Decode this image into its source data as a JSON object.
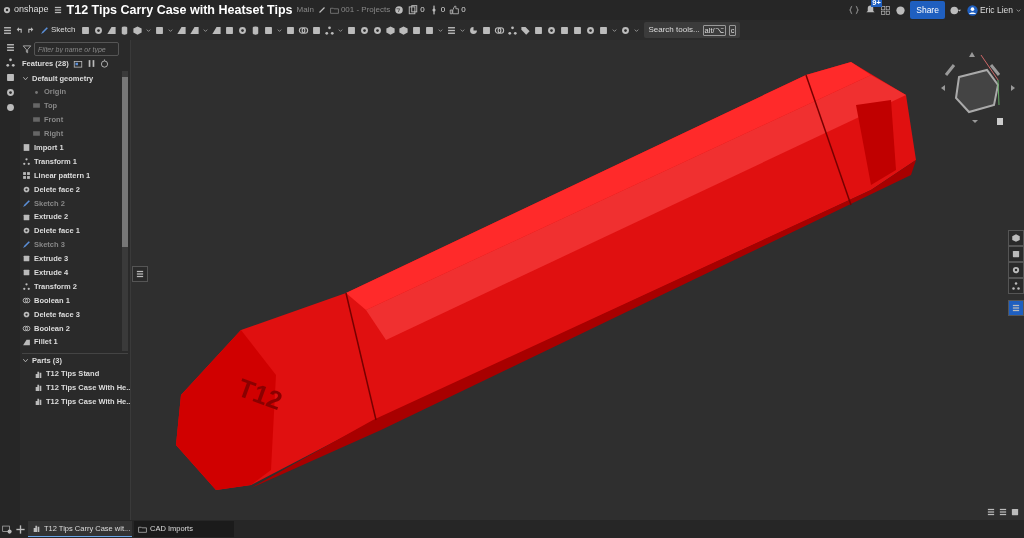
{
  "app": {
    "logo_text": "onshape",
    "title": "T12 Tips Carry Case with Heatset Tips",
    "branch": "Main",
    "folder": "001 - Projects",
    "counters": [
      {
        "kind": "versions",
        "value": "0"
      },
      {
        "kind": "branches",
        "value": "0"
      },
      {
        "kind": "likes",
        "value": "0"
      }
    ],
    "notification_badge": "9+",
    "share": "Share",
    "user": "Eric Lien"
  },
  "toolbar": {
    "sketch": "Sketch",
    "search_button": "Search tools...",
    "shortcut_keys": [
      "alt/⌥",
      "c"
    ]
  },
  "feature_panel": {
    "filter": {
      "placeholder": "Filter by name or type"
    },
    "title": "Features (28)",
    "features": [
      {
        "label": "Default geometry",
        "kind": "group",
        "expanded": true,
        "children": [
          {
            "label": "Origin",
            "kind": "origin"
          },
          {
            "label": "Top",
            "kind": "plane"
          },
          {
            "label": "Front",
            "kind": "plane"
          },
          {
            "label": "Right",
            "kind": "plane"
          }
        ]
      },
      {
        "label": "Import 1",
        "kind": "import"
      },
      {
        "label": "Transform 1",
        "kind": "transform"
      },
      {
        "label": "Linear pattern 1",
        "kind": "pattern"
      },
      {
        "label": "Delete face 2",
        "kind": "delete"
      },
      {
        "label": "Sketch 2",
        "kind": "sketch"
      },
      {
        "label": "Extrude 2",
        "kind": "extrude"
      },
      {
        "label": "Delete face 1",
        "kind": "delete"
      },
      {
        "label": "Sketch 3",
        "kind": "sketch"
      },
      {
        "label": "Extrude 3",
        "kind": "extrude"
      },
      {
        "label": "Extrude 4",
        "kind": "extrude"
      },
      {
        "label": "Transform 2",
        "kind": "transform"
      },
      {
        "label": "Boolean 1",
        "kind": "boolean"
      },
      {
        "label": "Delete face 3",
        "kind": "delete"
      },
      {
        "label": "Boolean 2",
        "kind": "boolean"
      },
      {
        "label": "Fillet 1",
        "kind": "fillet"
      }
    ],
    "parts_title": "Parts (3)",
    "parts_expanded": true,
    "parts": [
      {
        "label": "T12 Tips Stand"
      },
      {
        "label": "T12 Tips Case With He..."
      },
      {
        "label": "T12 Tips Case With He..."
      }
    ]
  },
  "model": {
    "label": "T12"
  },
  "tabs": [
    {
      "label": "T12 Tips Carry Case wit...",
      "kind": "partstudio",
      "selected": true
    },
    {
      "label": "CAD Imports",
      "kind": "folder",
      "selected": false
    }
  ]
}
